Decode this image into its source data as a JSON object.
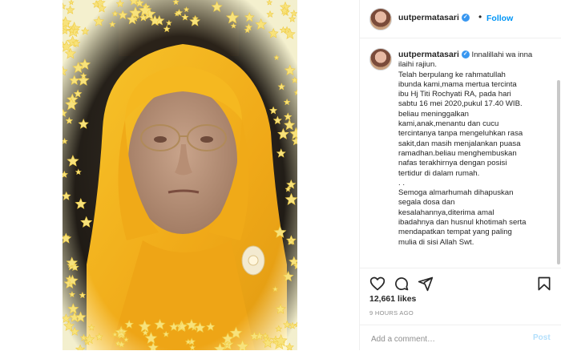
{
  "post": {
    "username": "uutpermatasari",
    "follow_label": "Follow",
    "dot": "•",
    "verified_mark": "✓",
    "caption_lines": [
      "Innalillahi wa inna",
      "ilaihi rajiun.",
      "Telah berpulang ke rahmatullah",
      "ibunda kami,mama mertua tercinta",
      "ibu Hj Titi Rochyati RA, pada hari",
      "sabtu 16 mei 2020,pukul 17.40 WIB.",
      "beliau meninggalkan",
      "kami,anak,menantu dan cucu",
      "tercintanya tanpa mengeluhkan rasa",
      "sakit,dan masih menjalankan puasa",
      "ramadhan.beliau menghembuskan",
      "nafas terakhirnya dengan posisi",
      "tertidur di dalam rumah.",
      ". .",
      "Semoga almarhumah dihapuskan",
      "segala dosa dan",
      "kesalahannya,diterima amal",
      "ibadahnya dan husnul khotimah serta",
      "mendapatkan tempat yang paling",
      "mulia di sisi Allah Swt."
    ],
    "likes": "12,661 likes",
    "time_ago": "9 HOURS AGO",
    "comment_placeholder": "Add a comment…",
    "post_label": "Post"
  },
  "icons": {
    "like": "heart-icon",
    "comment": "comment-icon",
    "share": "share-icon",
    "save": "bookmark-icon"
  },
  "colors": {
    "follow": "#0095f6",
    "verified": "#3897f0",
    "post_disabled": "#b2dffc",
    "hijab": "#f2b51c",
    "frame_stars": "#f6e27a"
  }
}
